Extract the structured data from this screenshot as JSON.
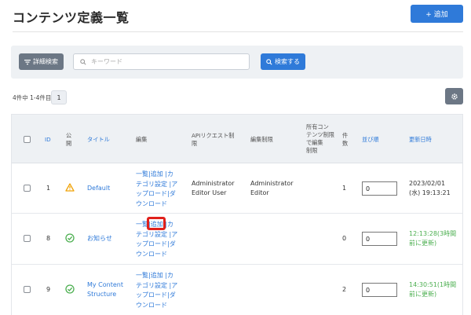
{
  "header": {
    "title": "コンテンツ定義一覧",
    "add_label": "+ 追加"
  },
  "search": {
    "advanced_label": "詳細検索",
    "keyword_placeholder": "キーワード",
    "search_label": "検索する"
  },
  "pagination": {
    "count_text": "4件中 1-4件目",
    "current_page": "1"
  },
  "table": {
    "headers": {
      "id": "ID",
      "published": "公\n開",
      "title": "タイトル",
      "edit": "編集",
      "api_limit": "APIリクエスト制\n限",
      "edit_limit": "編集制限",
      "owner_limit": "所有コン\nテンツ制限\nで編集\n制限",
      "count": "件\n数",
      "order": "並び順",
      "updated": "更新日時"
    },
    "rows": [
      {
        "id": "1",
        "status_icon": "warning-icon",
        "title": "Default",
        "edit_links": "一覧|追加 |カ\nテゴリ設定 |ア\nップロード|ダ\nウンロード",
        "api_limit": "Administrator\nEditor User",
        "edit_limit": "Administrator\nEditor",
        "count": "1",
        "order": "0",
        "updated": "2023/02/01\n(水) 19:13:21",
        "updated_color": "#333333"
      },
      {
        "id": "8",
        "status_icon": "check-circle-icon",
        "title": "お知らせ",
        "edit_links": "一覧|追加 |カ\nテゴリ設定 |ア\nップロード|ダ\nウンロード",
        "api_limit": "",
        "edit_limit": "",
        "count": "0",
        "order": "0",
        "updated": "12:13:28(3時間\n前に更新)",
        "updated_color": "#4caf50"
      },
      {
        "id": "9",
        "status_icon": "check-circle-icon",
        "title": "My Content\nStructure",
        "edit_links": "一覧|追加 |カ\nテゴリ設定 |ア\nップロード|ダ\nウンロード",
        "api_limit": "",
        "edit_limit": "",
        "count": "2",
        "order": "0",
        "updated": "14:30:51(1時間\n前に更新)",
        "updated_color": "#4caf50"
      }
    ]
  },
  "colors": {
    "primary": "#2f7ad9",
    "secondary": "#6c7785",
    "warning": "#f0a30a",
    "success": "#4caf50",
    "highlight": "#e0201c"
  }
}
